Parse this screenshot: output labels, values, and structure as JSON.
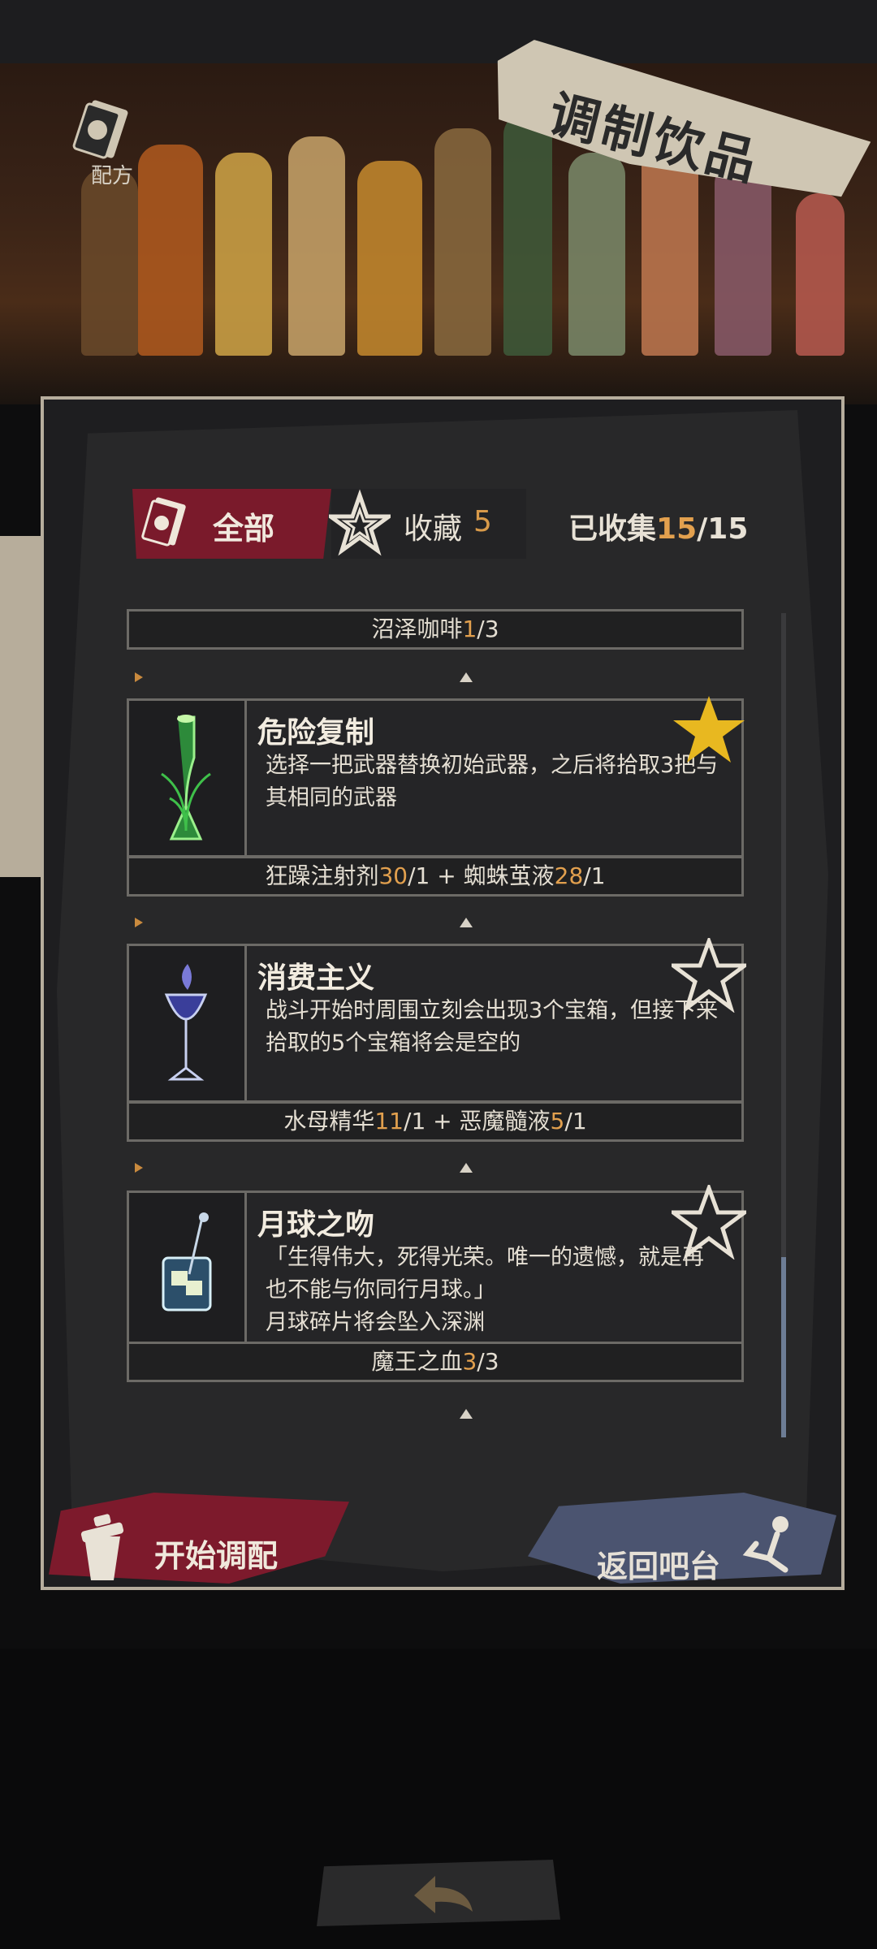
{
  "header": {
    "title": "调制饮品",
    "recipe_label": "配方"
  },
  "filters": {
    "all_label": "全部",
    "favorites_label": "收藏",
    "favorites_count": "5",
    "collected_label": "已收集",
    "collected_count": "15",
    "collected_total": "15"
  },
  "list": {
    "top_row": {
      "name": "沼泽咖啡",
      "have": "1",
      "need": "3"
    },
    "drinks": [
      {
        "name": "危险复制",
        "favorite": true,
        "desc": "选择一把武器替换初始武器，之后将拾取3把与其相同的武器",
        "ingredients": [
          {
            "name": "狂躁注射剂",
            "have": "30",
            "need": "1"
          },
          {
            "name": "蜘蛛茧液",
            "have": "28",
            "need": "1"
          }
        ]
      },
      {
        "name": "消费主义",
        "favorite": false,
        "desc": "战斗开始时周围立刻会出现3个宝箱，但接下来拾取的5个宝箱将会是空的",
        "ingredients": [
          {
            "name": "水母精华",
            "have": "11",
            "need": "1"
          },
          {
            "name": "恶魔髓液",
            "have": "5",
            "need": "1"
          }
        ]
      },
      {
        "name": "月球之吻",
        "favorite": false,
        "desc": "「生得伟大，死得光荣。唯一的遗憾，就是再也不能与你同行月球。」",
        "desc2": "月球碎片将会坠入深渊",
        "ingredients": [
          {
            "name": "魔王之血",
            "have": "3",
            "need": "3"
          }
        ]
      }
    ]
  },
  "buttons": {
    "start": "开始调配",
    "back_to_bar": "返回吧台"
  },
  "colors": {
    "accent_orange": "#e2a04e",
    "tab_red": "#7a1a2b",
    "star_gold": "#e8b820",
    "back_blue": "#4b5470"
  }
}
